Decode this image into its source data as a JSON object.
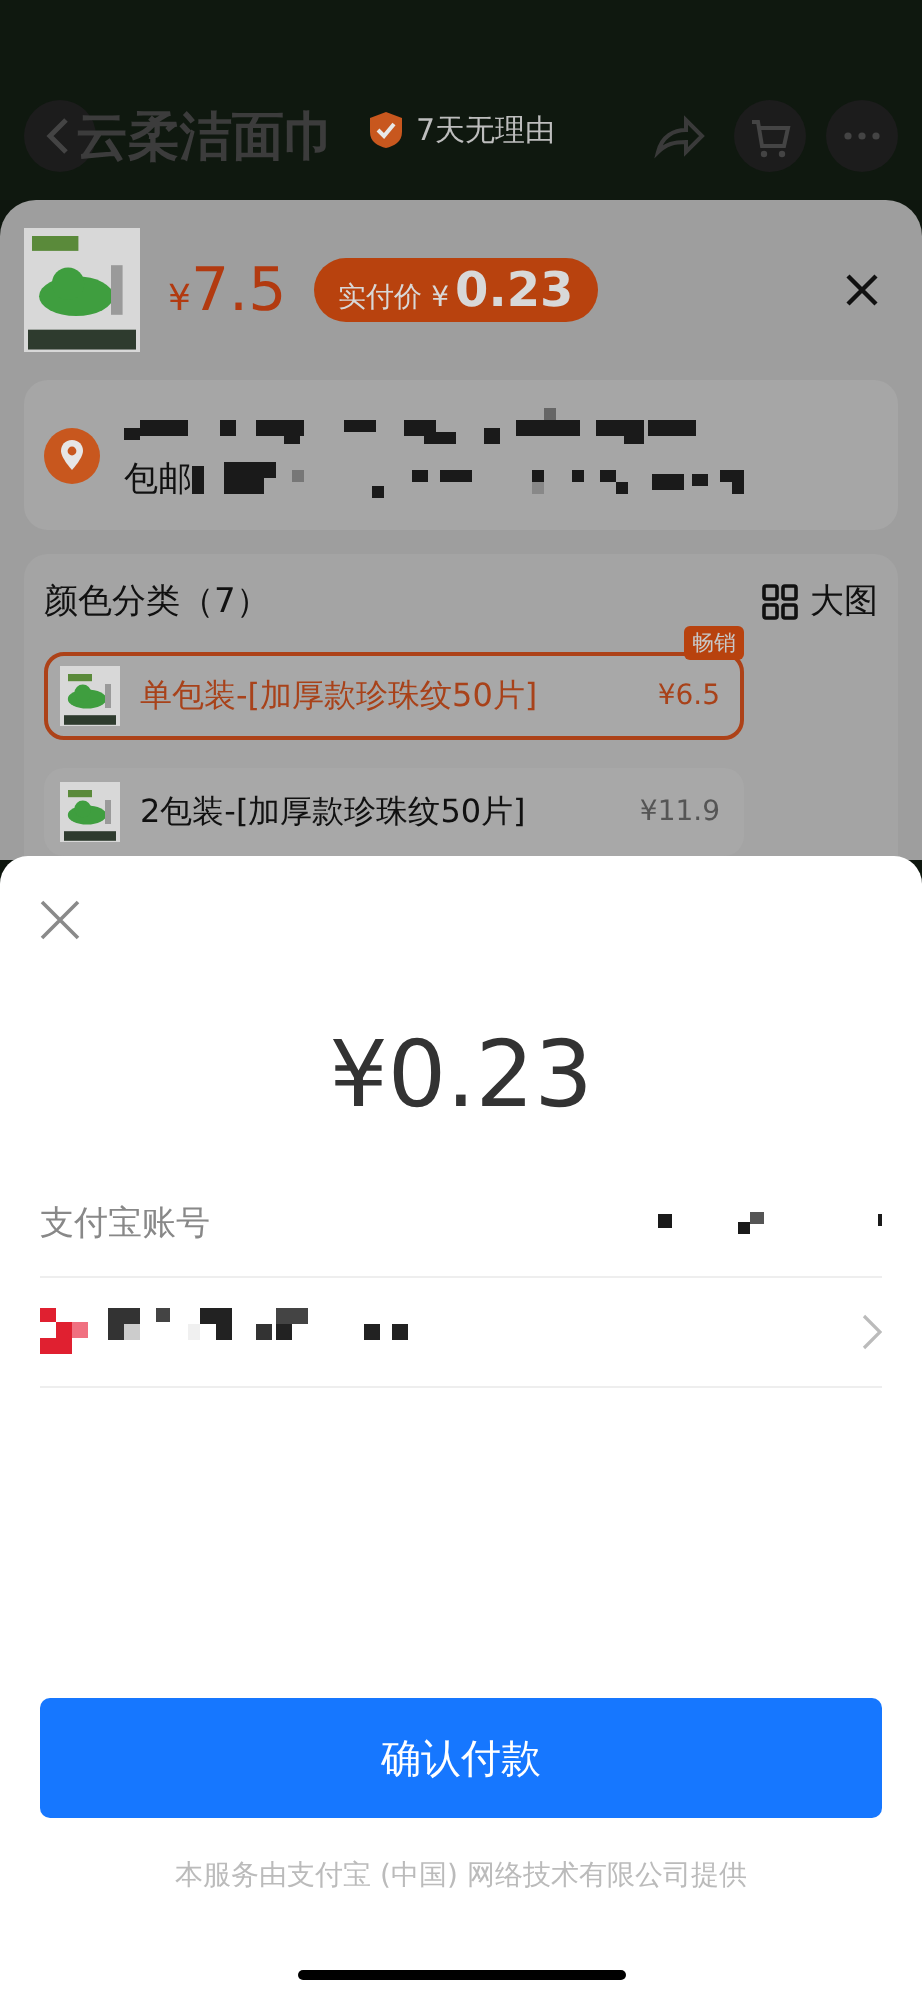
{
  "product_page": {
    "title": "云柔洁面巾",
    "badge": "7天无理由"
  },
  "sku_sheet": {
    "currency": "¥",
    "price": "7.5",
    "final_price_label": "实付价 ¥",
    "final_price": "0.23",
    "shipping": "包邮",
    "options_title": "颜色分类（7）",
    "view_toggle": "大图",
    "options": [
      {
        "name": "单包装-[加厚款珍珠纹50片]",
        "price": "¥6.5",
        "tag": "畅销",
        "selected": true
      },
      {
        "name": "2包装-[加厚款珍珠纹50片]",
        "price": "¥11.9",
        "selected": false
      }
    ]
  },
  "payment": {
    "amount": "¥0.23",
    "account_label": "支付宝账号",
    "button": "确认付款",
    "footer": "本服务由支付宝 (中国) 网络技术有限公司提供"
  }
}
